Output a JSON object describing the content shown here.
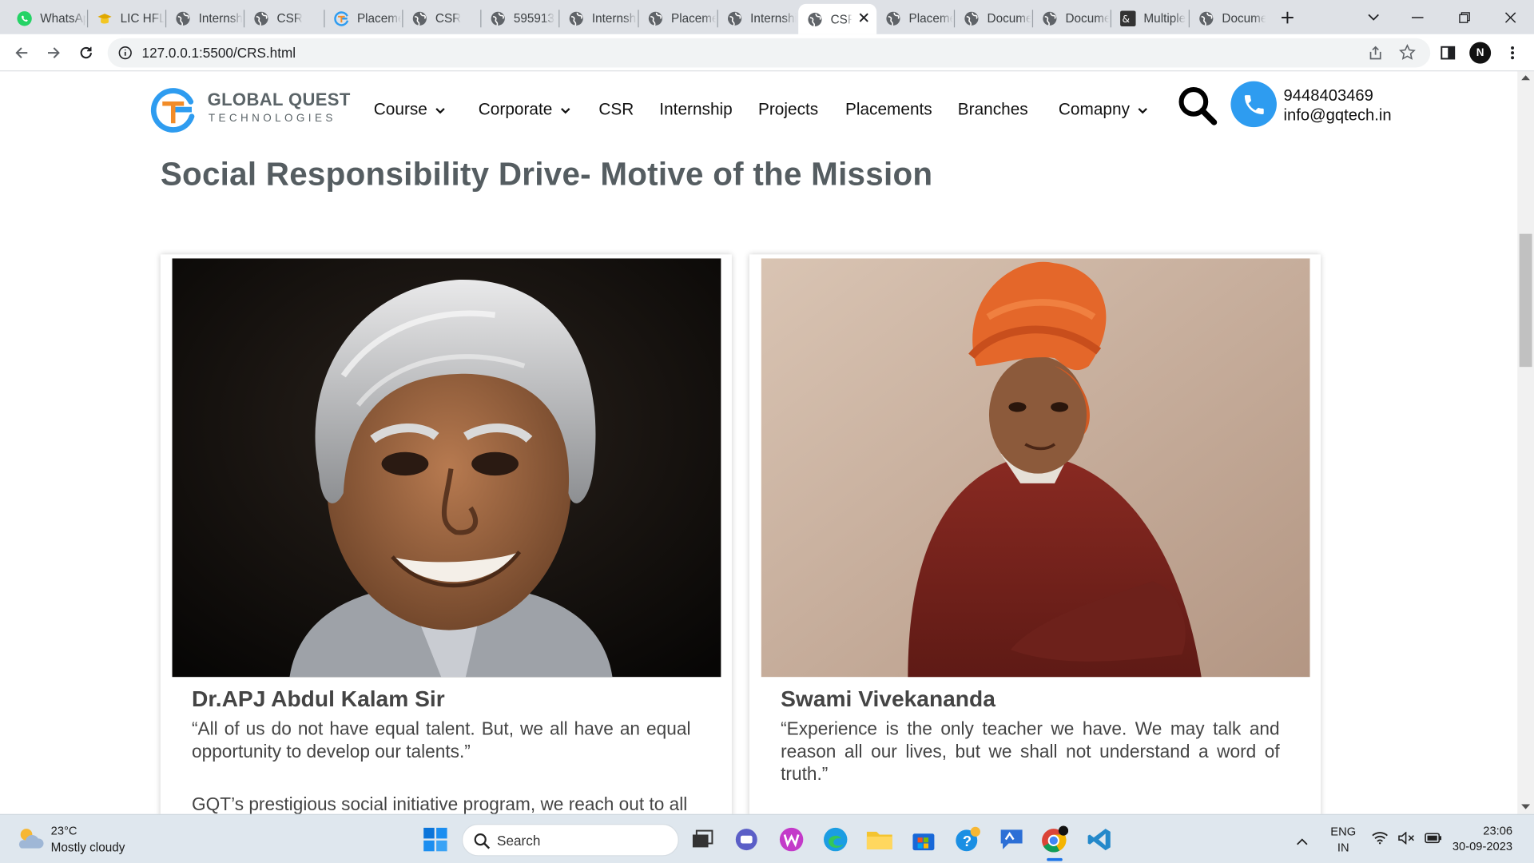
{
  "browser": {
    "tabs": [
      {
        "title": "WhatsApp",
        "icon": "whatsapp-icon"
      },
      {
        "title": "LIC HFL",
        "icon": "lic-icon"
      },
      {
        "title": "Internship",
        "icon": "globe-icon"
      },
      {
        "title": "CSR",
        "icon": "globe-icon"
      },
      {
        "title": "Placements",
        "icon": "gqt-icon"
      },
      {
        "title": "CSR",
        "icon": "globe-icon"
      },
      {
        "title": "595913",
        "icon": "globe-icon"
      },
      {
        "title": "Internship",
        "icon": "globe-icon"
      },
      {
        "title": "Placements",
        "icon": "globe-icon"
      },
      {
        "title": "Internship",
        "icon": "globe-icon"
      },
      {
        "title": "CSR",
        "icon": "globe-icon",
        "active": true
      },
      {
        "title": "Placements",
        "icon": "globe-icon"
      },
      {
        "title": "Document",
        "icon": "globe-icon"
      },
      {
        "title": "Document",
        "icon": "globe-icon"
      },
      {
        "title": "Multiple",
        "icon": "multiple-icon"
      },
      {
        "title": "Document",
        "icon": "globe-icon"
      }
    ],
    "url": "127.0.0.1:5500/CRS.html",
    "profile_initial": "N"
  },
  "site": {
    "logo_line1": "GLOBAL QUEST",
    "logo_line2": "TECHNOLOGIES",
    "menu": [
      {
        "label": "Course",
        "dropdown": true
      },
      {
        "label": "Corporate",
        "dropdown": true
      },
      {
        "label": "CSR",
        "dropdown": false
      },
      {
        "label": "Internship",
        "dropdown": false
      },
      {
        "label": "Projects",
        "dropdown": false
      },
      {
        "label": "Placements",
        "dropdown": false
      },
      {
        "label": "Branches",
        "dropdown": false
      },
      {
        "label": "Comapny",
        "dropdown": true
      }
    ],
    "phone": "9448403469",
    "email": "info@gqtech.in"
  },
  "page": {
    "title": "Social Responsibility Drive- Motive of the Mission",
    "cards": [
      {
        "name": "Dr.APJ Abdul Kalam Sir",
        "quote": "“All of us do not have equal talent. But, we all have an equal opportunity to develop our talents.”",
        "paragraph": "GQT’s prestigious social initiative program, we reach out to all"
      },
      {
        "name": "Swami Vivekananda",
        "quote": "“Experience is the only teacher we have. We may talk and reason all our lives, but we shall not understand a word of truth.”",
        "paragraph": ""
      }
    ]
  },
  "taskbar": {
    "temperature": "23°C",
    "weather": "Mostly cloudy",
    "search_label": "Search",
    "language_line1": "ENG",
    "language_line2": "IN",
    "time": "23:06",
    "date": "30-09-2023"
  },
  "colors": {
    "brand_blue": "#2e9cf0",
    "brand_orange": "#f28c28",
    "title_gray": "#555d61"
  }
}
